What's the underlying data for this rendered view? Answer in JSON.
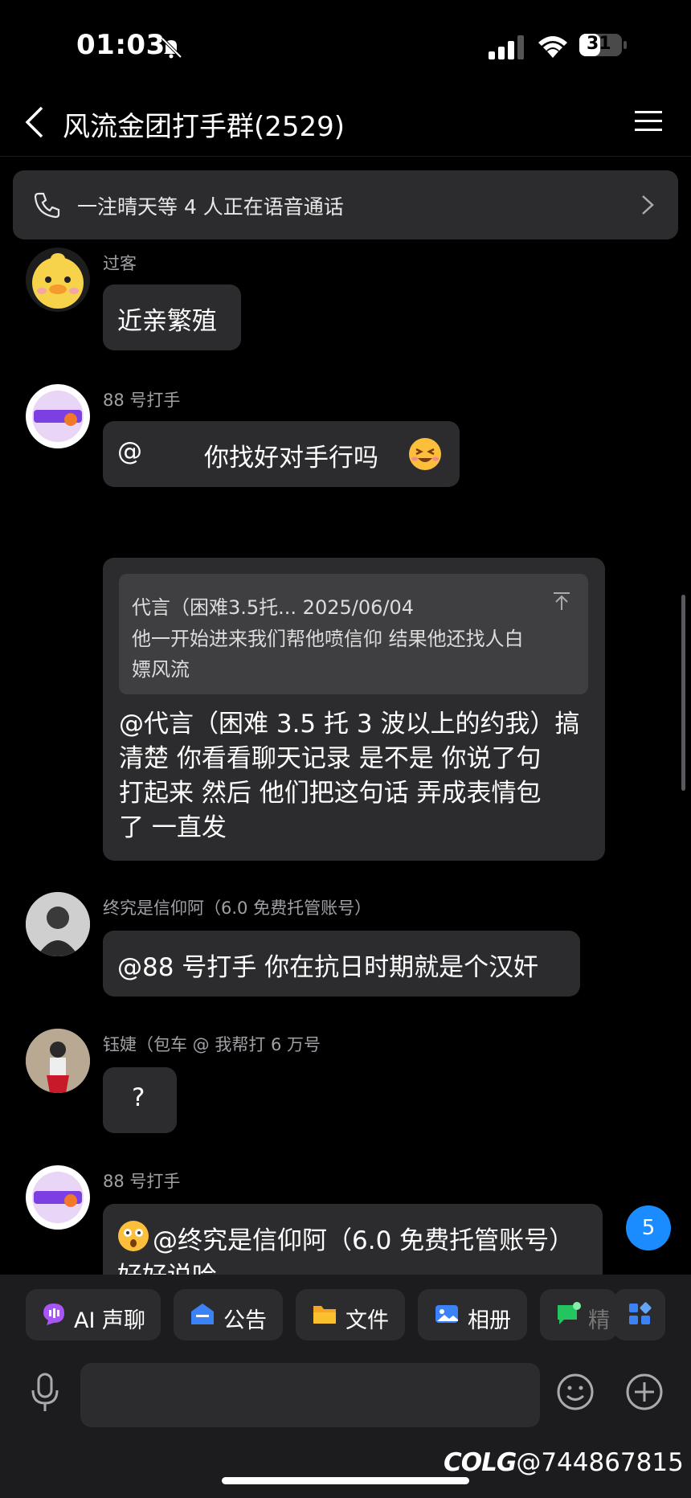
{
  "status_bar": {
    "time": "01:03",
    "battery": "31"
  },
  "nav": {
    "title": "风流金团打手群(2529)"
  },
  "voice_banner": {
    "text": "一注晴天等 4 人正在语音通话"
  },
  "messages": [
    {
      "sender": "过客",
      "text": "近亲繁殖"
    },
    {
      "sender": "88 号打手",
      "text_at": "@",
      "text_main": "你找好对手行吗"
    },
    {
      "quote": {
        "header": "代言（困难3.5托... 2025/06/04",
        "line1": "他一开始进来我们帮他喷信仰 结果他还找人白",
        "line2": "嫖风流"
      },
      "lines": [
        "@代言（困难 3.5 托 3 波以上的约我）搞",
        "清楚  你看看聊天记录  是不是 你说了句",
        "打起来  然后  他们把这句话 弄成表情包",
        "了  一直发"
      ]
    },
    {
      "sender": "终究是信仰阿（6.0 免费托管账号）",
      "text": "@88 号打手 你在抗日时期就是个汉奸"
    },
    {
      "sender": "钰婕（包车 @ 我帮打 6 万号",
      "text": "?"
    },
    {
      "sender": "88 号打手",
      "text": "@终究是信仰阿（6.0 免费托管账号）",
      "text2": "好好说哈"
    }
  ],
  "unread_badge": "5",
  "toolbar": [
    {
      "label": "AI 声聊",
      "icon": "ai-voice-icon"
    },
    {
      "label": "公告",
      "icon": "announcement-icon"
    },
    {
      "label": "文件",
      "icon": "folder-icon"
    },
    {
      "label": "相册",
      "icon": "album-icon"
    },
    {
      "label": "精",
      "icon": "essence-icon"
    },
    {
      "label": "",
      "icon": "apps-icon"
    }
  ],
  "watermark": {
    "brand": "COLG",
    "handle": "@744867815"
  },
  "colors": {
    "background": "#000000",
    "bubble": "#2c2c2e",
    "badge": "#1a8cff"
  }
}
